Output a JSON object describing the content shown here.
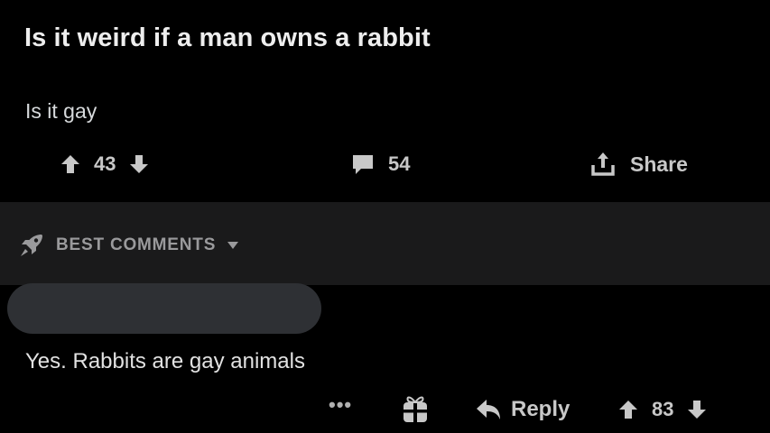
{
  "post": {
    "title": "Is it weird if a man owns a rabbit",
    "body": "Is it gay",
    "upvotes": "43",
    "comment_count": "54",
    "share_label": "Share"
  },
  "sort": {
    "label": "BEST COMMENTS",
    "icon": "rocket-icon"
  },
  "comment": {
    "text": "Yes. Rabbits are gay animals",
    "more_label": "•••",
    "reply_label": "Reply",
    "votes": "83"
  },
  "colors": {
    "background": "#000000",
    "sort_bar": "#1a1a1b",
    "author_pill": "#2e3034",
    "icon": "#c8c8c8"
  }
}
